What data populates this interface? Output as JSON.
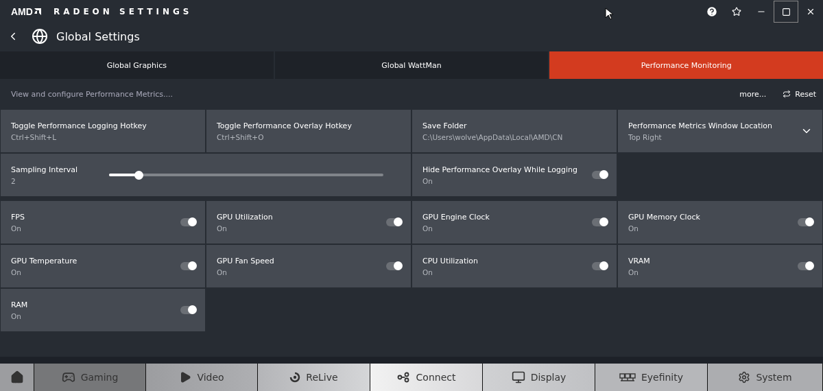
{
  "window": {
    "brand": "AMD",
    "title": "RADEON SETTINGS"
  },
  "header": {
    "title": "Global Settings"
  },
  "tabs": [
    {
      "label": "Global Graphics",
      "selected": false
    },
    {
      "label": "Global WattMan",
      "selected": false
    },
    {
      "label": "Performance Monitoring",
      "selected": true
    }
  ],
  "info": {
    "text": "View and configure Performance Metrics....",
    "more": "more...",
    "reset": "Reset"
  },
  "settings": [
    {
      "kind": "value",
      "label": "Toggle Performance Logging Hotkey",
      "value": "Ctrl+Shift+L"
    },
    {
      "kind": "value",
      "label": "Toggle Performance Overlay Hotkey",
      "value": "Ctrl+Shift+O"
    },
    {
      "kind": "value",
      "label": "Save Folder",
      "value": "C:\\Users\\wolve\\AppData\\Local\\AMD\\CN"
    },
    {
      "kind": "dropdown",
      "label": "Performance Metrics Window Location",
      "value": "Top Right"
    },
    {
      "kind": "slider",
      "label": "Sampling Interval",
      "value": "2",
      "level": 0.11
    },
    {
      "kind": "toggle",
      "label": "Hide Performance Overlay While Logging",
      "value": "On",
      "on": true
    }
  ],
  "metrics": [
    {
      "label": "FPS",
      "value": "On",
      "on": true
    },
    {
      "label": "GPU Utilization",
      "value": "On",
      "on": true
    },
    {
      "label": "GPU Engine Clock",
      "value": "On",
      "on": true
    },
    {
      "label": "GPU Memory Clock",
      "value": "On",
      "on": true
    },
    {
      "label": "GPU Temperature",
      "value": "On",
      "on": true
    },
    {
      "label": "GPU Fan Speed",
      "value": "On",
      "on": true
    },
    {
      "label": "CPU Utilization",
      "value": "On",
      "on": true
    },
    {
      "label": "VRAM",
      "value": "On",
      "on": true
    },
    {
      "label": "RAM",
      "value": "On",
      "on": true
    }
  ],
  "nav": [
    {
      "kind": "home",
      "selected": false
    },
    {
      "kind": "gaming",
      "label": "Gaming",
      "selected": true
    },
    {
      "kind": "video",
      "label": "Video",
      "selected": false
    },
    {
      "kind": "relive",
      "label": "ReLive",
      "selected": false
    },
    {
      "kind": "connect",
      "label": "Connect",
      "selected": false
    },
    {
      "kind": "display",
      "label": "Display",
      "selected": false
    },
    {
      "kind": "eyefinity",
      "label": "Eyefinity",
      "selected": false
    },
    {
      "kind": "system",
      "label": "System",
      "selected": false
    }
  ]
}
